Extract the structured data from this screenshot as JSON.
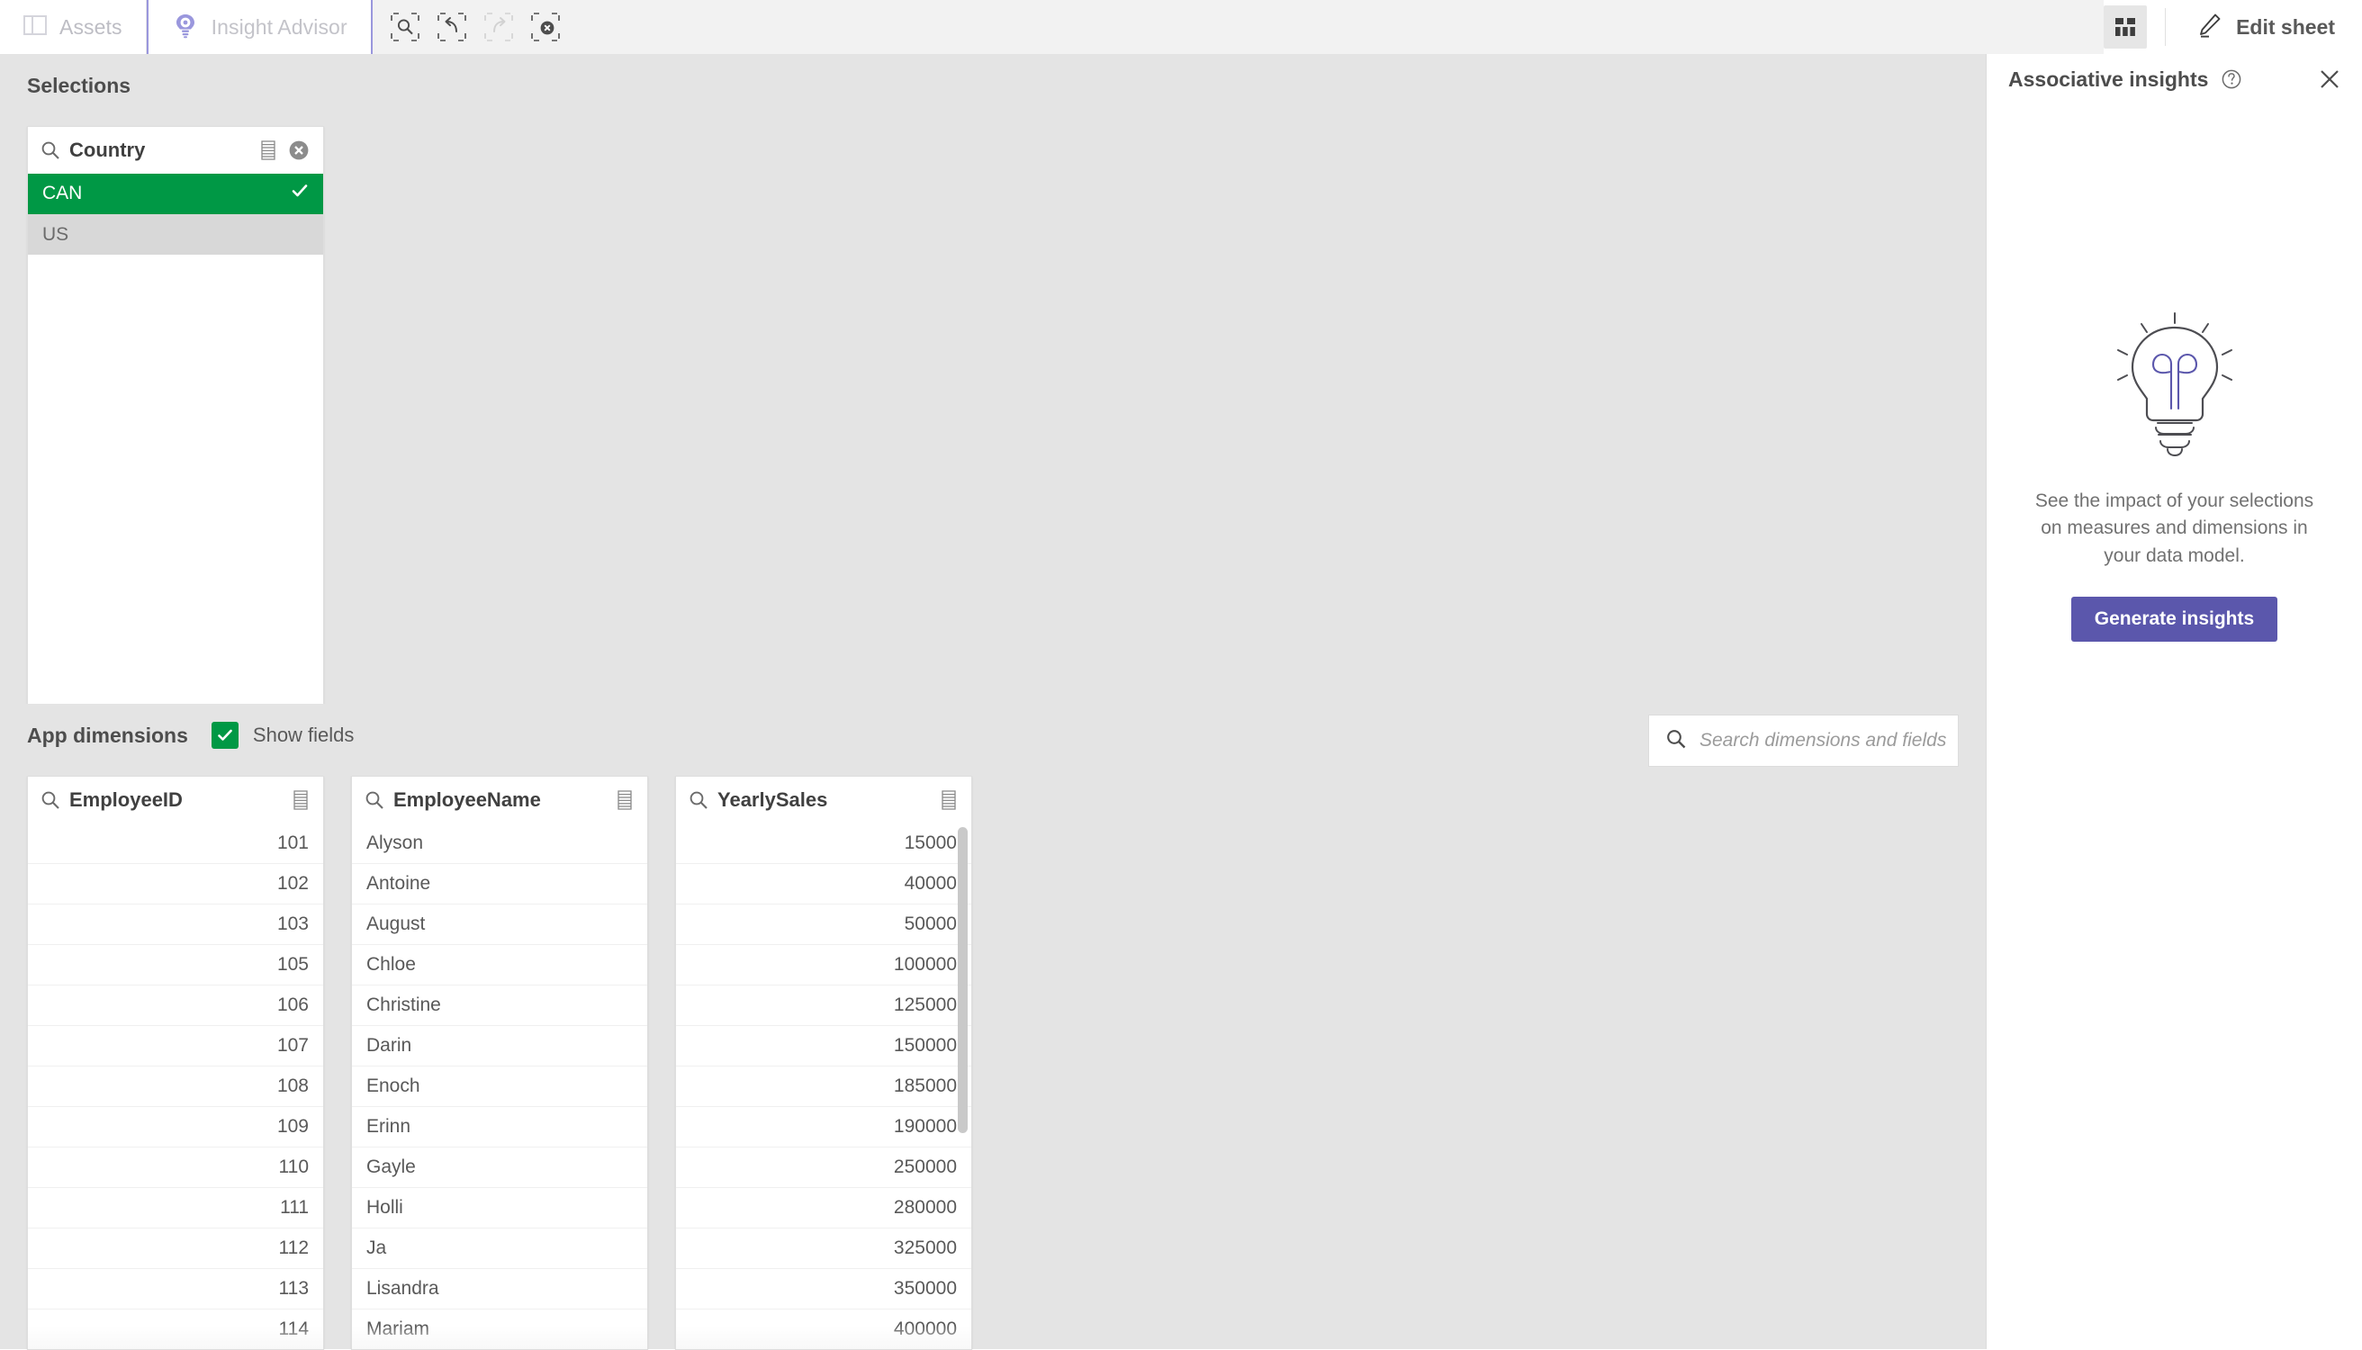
{
  "toolbar": {
    "tabs": [
      {
        "label": "Assets",
        "icon": "panel-icon",
        "active": false
      },
      {
        "label": "Insight Advisor",
        "icon": "insight-bulb-icon",
        "active": true
      }
    ],
    "selection_tools": [
      {
        "name": "search-selections-icon",
        "enabled": true
      },
      {
        "name": "step-back-icon",
        "enabled": true
      },
      {
        "name": "step-forward-icon",
        "enabled": false
      },
      {
        "name": "clear-all-selections-icon",
        "enabled": true
      }
    ],
    "sheet_button_icon": "sheet-grid-icon",
    "edit_sheet_label": "Edit sheet",
    "edit_sheet_icon": "pencil-icon"
  },
  "selections": {
    "title": "Selections",
    "listbox": {
      "field": "Country",
      "search_icon": "search-icon",
      "menu_icon": "list-menu-icon",
      "clear_icon": "clear-selection-icon",
      "values": [
        {
          "label": "CAN",
          "state": "selected"
        },
        {
          "label": "US",
          "state": "alternative"
        }
      ]
    }
  },
  "insights": {
    "title": "Associative insights",
    "help_icon": "help-circle-icon",
    "close_icon": "close-icon",
    "illustration": "lightbulb-illustration",
    "empty_message": "See the impact of your selections on measures and dimensions in your data model.",
    "generate_button": "Generate insights",
    "accent_color": "#5b57ac"
  },
  "app_dimensions": {
    "title": "App dimensions",
    "show_fields_label": "Show fields",
    "show_fields_checked": true,
    "checkbox_color": "#009845",
    "search": {
      "placeholder": "Search dimensions and fields",
      "value": "",
      "icon": "search-icon"
    },
    "fields": [
      {
        "name": "EmployeeID",
        "align": "right",
        "search_icon": "search-icon",
        "menu_icon": "list-menu-icon",
        "scrollbar": false,
        "values": [
          "101",
          "102",
          "103",
          "105",
          "106",
          "107",
          "108",
          "109",
          "110",
          "111",
          "112",
          "113",
          "114"
        ]
      },
      {
        "name": "EmployeeName",
        "align": "left",
        "search_icon": "search-icon",
        "menu_icon": "list-menu-icon",
        "scrollbar": false,
        "values": [
          "Alyson",
          "Antoine",
          "August",
          "Chloe",
          "Christine",
          "Darin",
          "Enoch",
          "Erinn",
          "Gayle",
          "Holli",
          "Ja",
          "Lisandra",
          "Mariam"
        ]
      },
      {
        "name": "YearlySales",
        "align": "right",
        "search_icon": "search-icon",
        "menu_icon": "list-menu-icon",
        "scrollbar": true,
        "values": [
          "15000",
          "40000",
          "50000",
          "100000",
          "125000",
          "150000",
          "185000",
          "190000",
          "250000",
          "280000",
          "325000",
          "350000",
          "400000"
        ]
      }
    ]
  },
  "colors": {
    "selected_green": "#009845",
    "alternative_grey": "#d8d8d8",
    "insight_purple": "#5b57ac",
    "tab_accent": "#9a97dd",
    "pane_background": "#e4e4e4"
  }
}
